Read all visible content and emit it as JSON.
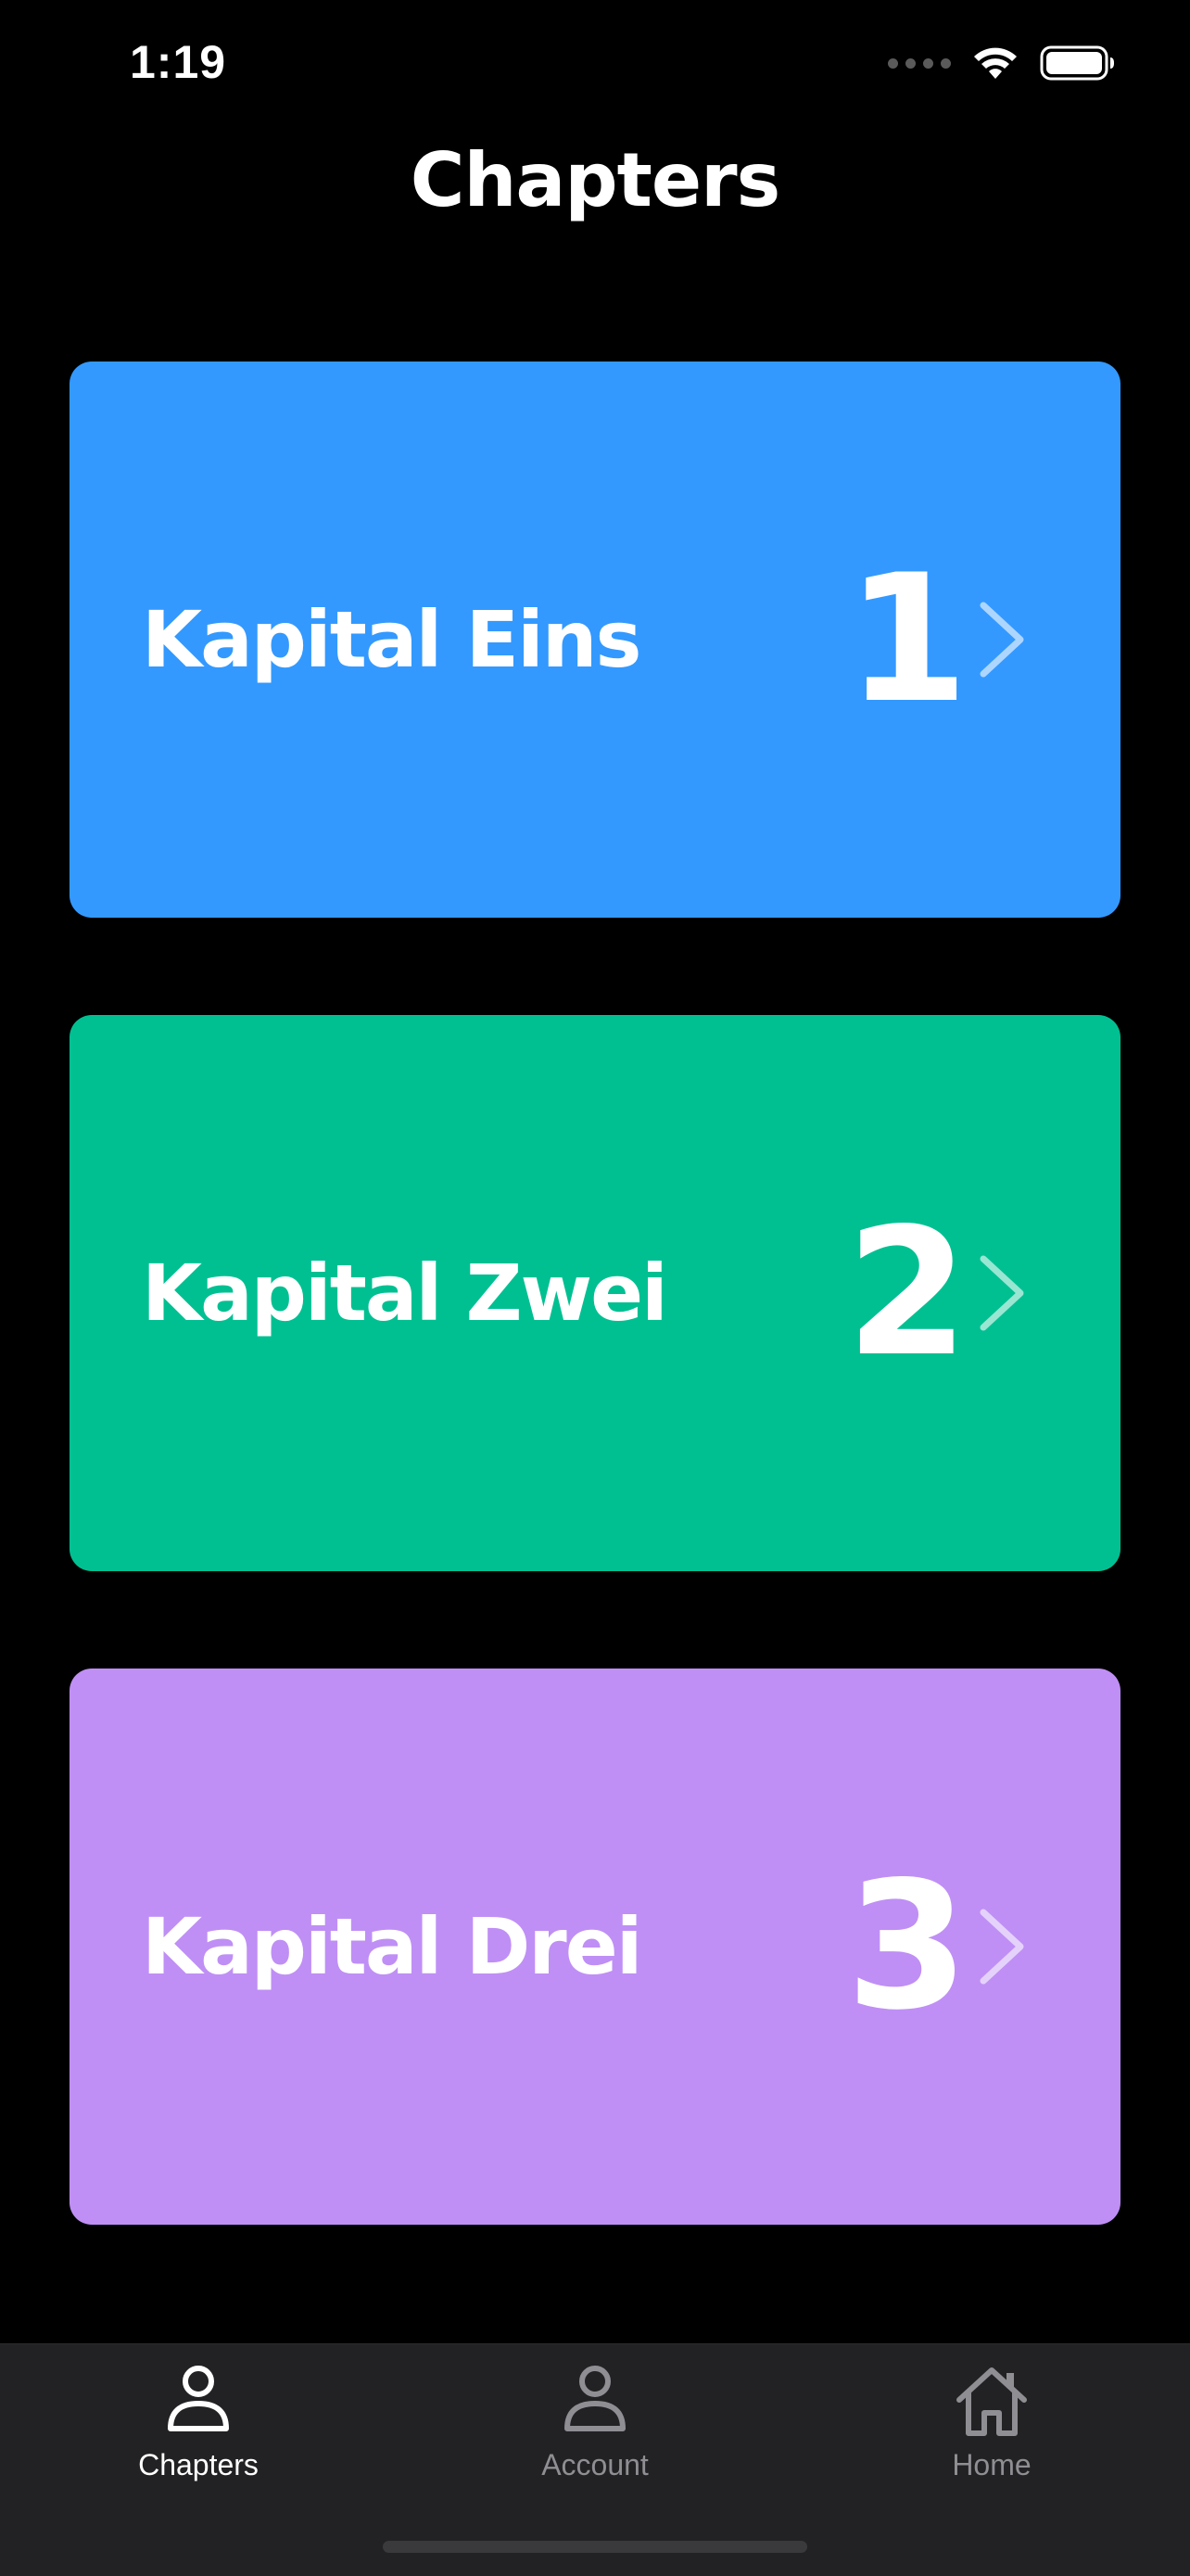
{
  "status_bar": {
    "time": "1:19"
  },
  "header": {
    "title": "Chapters"
  },
  "chapters": [
    {
      "name": "Kapital Eins",
      "number": "1",
      "color": "#3399FF"
    },
    {
      "name": "Kapital Zwei",
      "number": "2",
      "color": "#00C092"
    },
    {
      "name": "Kapital Drei",
      "number": "3",
      "color": "#BF8FF5"
    }
  ],
  "tab_bar": {
    "tabs": [
      {
        "label": "Chapters",
        "icon": "person-icon",
        "active": true
      },
      {
        "label": "Account",
        "icon": "person-icon",
        "active": false
      },
      {
        "label": "Home",
        "icon": "house-icon",
        "active": false
      }
    ]
  },
  "colors": {
    "background": "#000000",
    "tab_bar_background": "#222224",
    "tab_active": "#FFFFFF",
    "tab_inactive": "#8E8E93"
  }
}
